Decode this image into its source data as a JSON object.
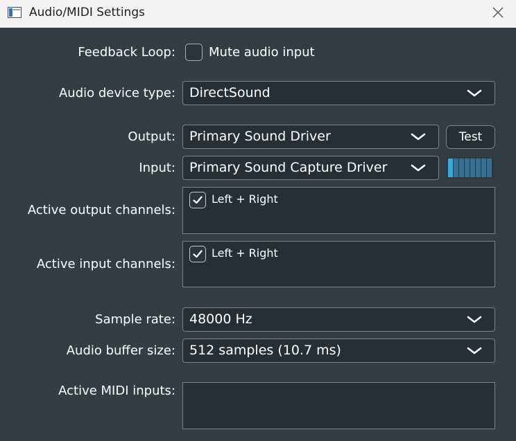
{
  "window": {
    "title": "Audio/MIDI Settings"
  },
  "feedback_loop": {
    "label": "Feedback Loop:",
    "checkbox_label": "Mute audio input",
    "checked": false
  },
  "audio_device_type": {
    "label": "Audio device type:",
    "value": "DirectSound"
  },
  "output": {
    "label": "Output:",
    "value": "Primary Sound Driver",
    "test_label": "Test"
  },
  "input": {
    "label": "Input:",
    "value": "Primary Sound Capture Driver",
    "level": 0.125
  },
  "active_output_channels": {
    "label": "Active output channels:",
    "items": [
      {
        "label": "Left + Right",
        "checked": true
      }
    ]
  },
  "active_input_channels": {
    "label": "Active input channels:",
    "items": [
      {
        "label": "Left + Right",
        "checked": true
      }
    ]
  },
  "sample_rate": {
    "label": "Sample rate:",
    "value": "48000 Hz"
  },
  "audio_buffer_size": {
    "label": "Audio buffer size:",
    "value": "512 samples (10.7 ms)"
  },
  "active_midi_inputs": {
    "label": "Active MIDI inputs:",
    "items": []
  },
  "colors": {
    "background": "#323e44",
    "field": "#262f35",
    "border": "#7b868b",
    "meter_active": "#3ea8d5",
    "meter_idle": "#3b6f8e"
  },
  "icons": {
    "app": "window-icon",
    "close": "close-icon",
    "dropdown": "chevron-down-icon",
    "check": "checkmark-icon"
  }
}
